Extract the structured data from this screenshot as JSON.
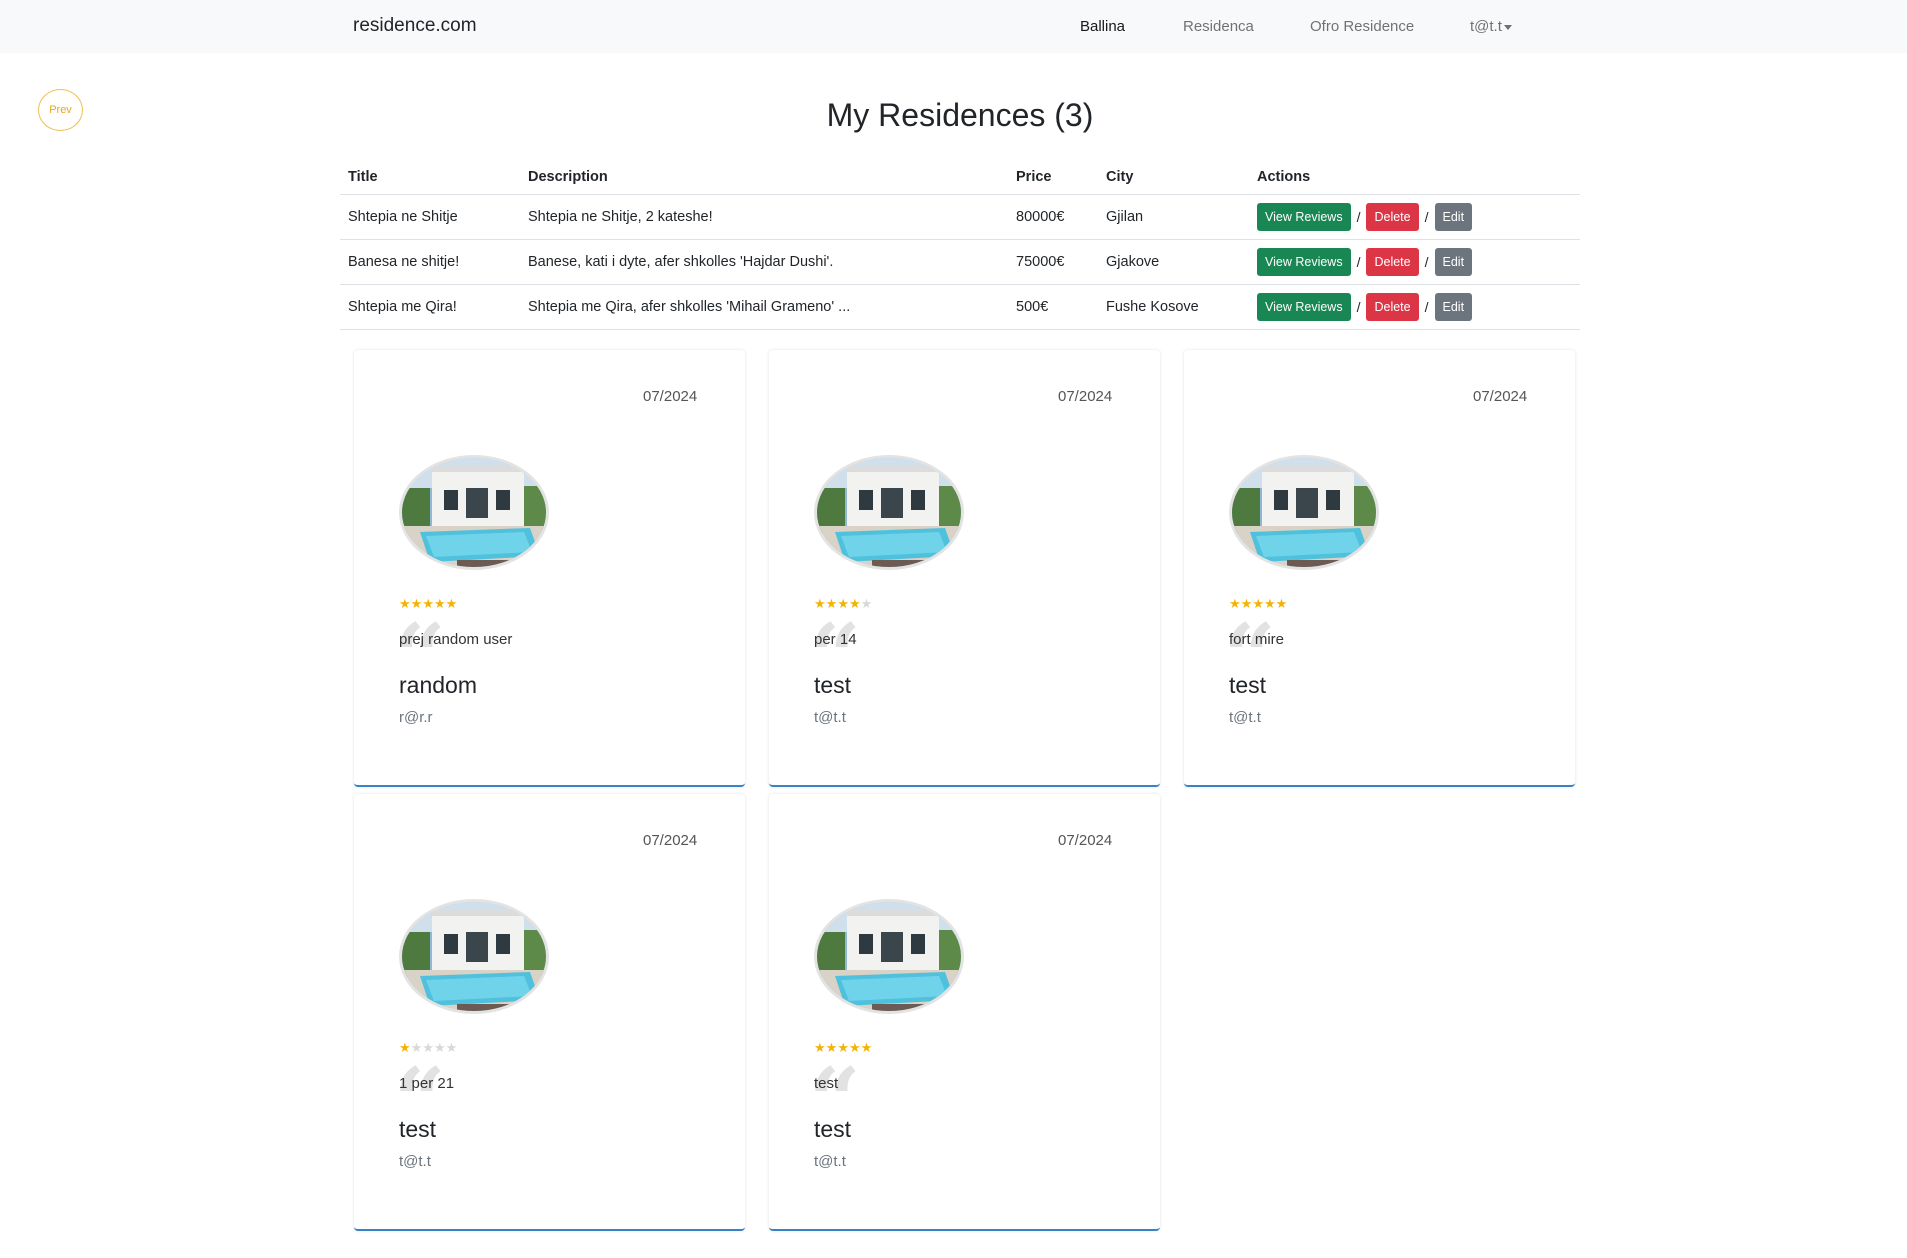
{
  "navbar": {
    "brand": "residence.com",
    "links": [
      "Ballina",
      "Residenca",
      "Ofro Residence"
    ],
    "user_menu": "t@t.t"
  },
  "prev_button": "Prev",
  "page_title": "My Residences (3)",
  "table": {
    "headers": [
      "Title",
      "Description",
      "Price",
      "City",
      "Actions"
    ],
    "rows": [
      {
        "title": "Shtepia ne Shitje",
        "description": "Shtepia ne Shitje, 2 kateshe!",
        "price": "80000€",
        "city": "Gjilan"
      },
      {
        "title": "Banesa ne shitje!",
        "description": "Banese, kati i dyte, afer shkolles 'Hajdar Dushi'.",
        "price": "75000€",
        "city": "Gjakove"
      },
      {
        "title": "Shtepia me Qira!",
        "description": "Shtepia me Qira, afer shkolles 'Mihail Grameno' ...",
        "price": "500€",
        "city": "Fushe Kosove"
      }
    ],
    "actions": {
      "view": "View Reviews",
      "delete": "Delete",
      "edit": "Edit",
      "separator": "/"
    }
  },
  "reviews": [
    {
      "date": "07/2024",
      "rating": 5,
      "comment": "prej random user",
      "name": "random",
      "email": "r@r.r"
    },
    {
      "date": "07/2024",
      "rating": 4,
      "comment": "per 14",
      "name": "test",
      "email": "t@t.t"
    },
    {
      "date": "07/2024",
      "rating": 5,
      "comment": "fort mire",
      "name": "test",
      "email": "t@t.t"
    },
    {
      "date": "07/2024",
      "rating": 1,
      "comment": "1 per 21",
      "name": "test",
      "email": "t@t.t"
    },
    {
      "date": "07/2024",
      "rating": 5,
      "comment": "test",
      "name": "test",
      "email": "t@t.t"
    }
  ],
  "colors": {
    "star_filled": "#f5b301",
    "star_empty": "#d8d8d8",
    "success": "#198754",
    "danger": "#dc3545",
    "secondary": "#6c757d",
    "card_accent": "#3b82c4"
  },
  "icons": {
    "star": "star-icon",
    "quote": "quote-icon",
    "caret": "caret-down-icon"
  }
}
